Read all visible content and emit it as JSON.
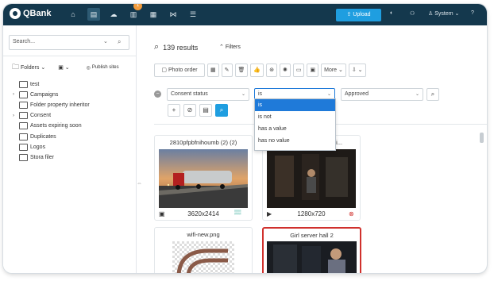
{
  "app": {
    "logo_text": "QBank"
  },
  "topbar": {
    "nav_icons": [
      "home-icon",
      "media-icon",
      "cloud-icon",
      "tasks-icon",
      "calendar-icon",
      "workflow-icon",
      "list-icon"
    ],
    "badge_count": "1",
    "upload_label": "Upload",
    "user_label": "System"
  },
  "sidebar": {
    "search_placeholder": "Search...",
    "folders_label": "Folders",
    "publish_label": "Publish sites",
    "tree": [
      {
        "label": "test",
        "expandable": false
      },
      {
        "label": "Campaigns",
        "expandable": true
      },
      {
        "label": "Folder property inheritor",
        "expandable": false
      },
      {
        "label": "Consent",
        "expandable": true
      },
      {
        "label": "Assets expiring soon",
        "expandable": false
      },
      {
        "label": "Duplicates",
        "expandable": false
      },
      {
        "label": "Logos",
        "expandable": false
      },
      {
        "label": "Stora filer",
        "expandable": false
      }
    ]
  },
  "main": {
    "results_label": "139 results",
    "filters_label": "Filters",
    "toolbar": {
      "photo_order_label": "Photo order",
      "more_label": "More"
    },
    "filter": {
      "field_value": "Consent status",
      "operator_value": "is",
      "value_value": "Approved",
      "operator_options": [
        "is",
        "is not",
        "has a value",
        "has no value"
      ]
    },
    "cards": [
      {
        "title": "2810pfpbfnihoumb (2) (2)",
        "dimensions": "3620x2414"
      },
      {
        "title": "Girl server hall - Offici...",
        "dimensions": "1280x720"
      },
      {
        "title": "wifi-new.png",
        "dimensions": ""
      },
      {
        "title": "Girl server hall 2",
        "dimensions": ""
      }
    ]
  },
  "colors": {
    "topbar": "#14384d",
    "accent": "#1f9ee0",
    "selected_border": "#d0312d",
    "badge": "#f39c3c"
  }
}
